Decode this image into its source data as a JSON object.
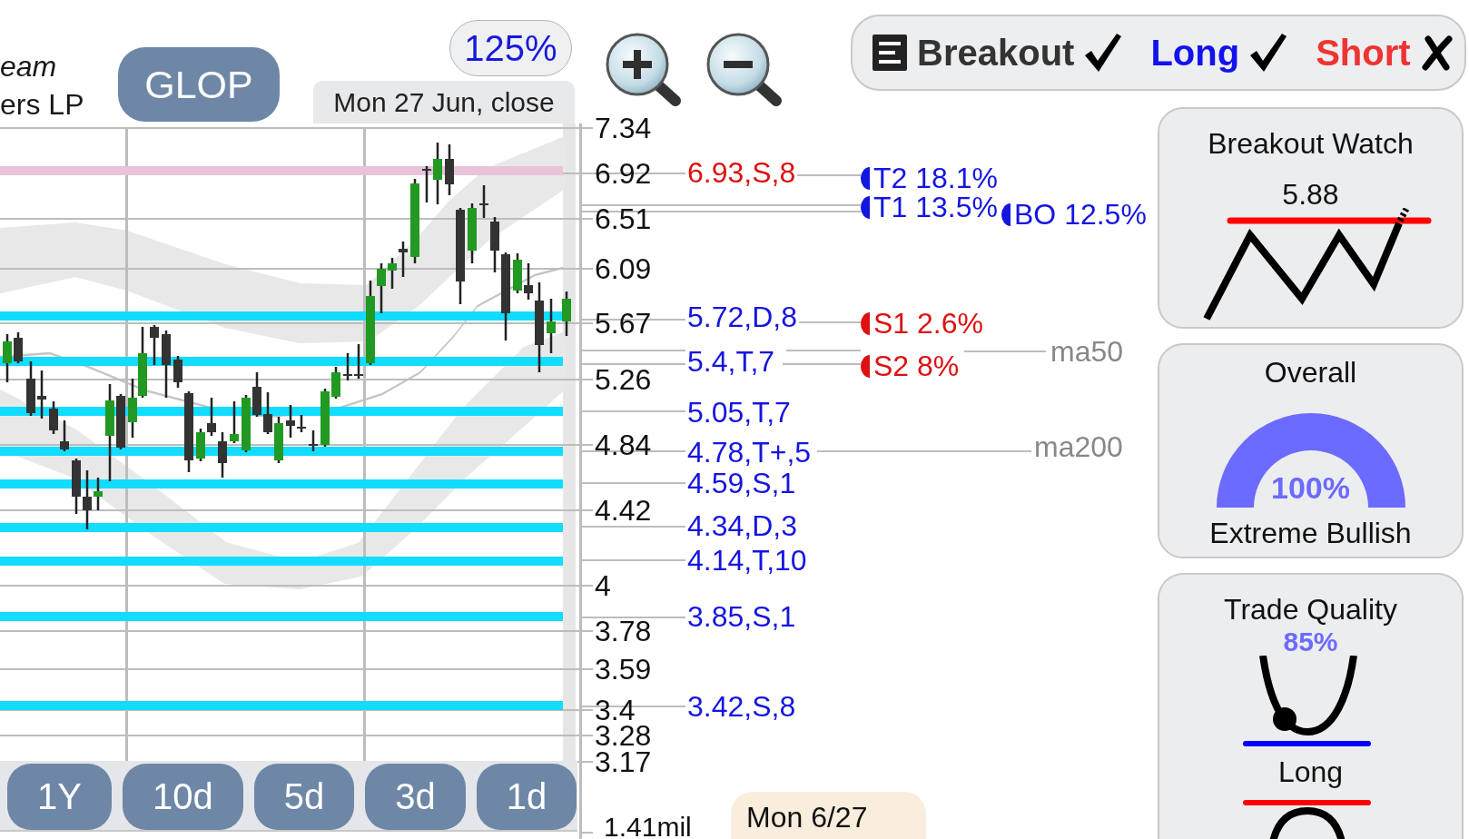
{
  "company": {
    "name": "eam",
    "subtitle": "ers LP"
  },
  "ticker": "GLOP",
  "zoom": "125%",
  "date_label": "Mon 27 Jun, close",
  "signals": [
    {
      "kind": "pattern",
      "label": "Breakout",
      "checked": true
    },
    {
      "kind": "long",
      "label": "Long",
      "checked": true
    },
    {
      "kind": "short",
      "label": "Short",
      "checked": false
    }
  ],
  "chart": {
    "price_ticks": [
      "7.34",
      "6.92",
      "6.51",
      "6.09",
      "5.67",
      "5.26",
      "4.84",
      "4.42",
      "4",
      "3.78",
      "3.59",
      "3.4",
      "3.28",
      "3.17"
    ],
    "levels": [
      {
        "label": "6.93,S,8",
        "kind": "resistance"
      },
      {
        "label": "5.72,D,8",
        "kind": "support"
      },
      {
        "label": "5.4,T,7",
        "kind": "support"
      },
      {
        "label": "5.05,T,7",
        "kind": "support"
      },
      {
        "label": "4.78,T+,5",
        "kind": "support"
      },
      {
        "label": "4.59,S,1",
        "kind": "support"
      },
      {
        "label": "4.34,D,3",
        "kind": "support"
      },
      {
        "label": "4.14,T,10",
        "kind": "support"
      },
      {
        "label": "3.85,S,1",
        "kind": "support"
      },
      {
        "label": "3.42,S,8",
        "kind": "support"
      }
    ],
    "targets": [
      {
        "label": "T2 18.1%",
        "kind": "target"
      },
      {
        "label": "T1 13.5%",
        "kind": "target"
      },
      {
        "label": "BO 12.5%",
        "kind": "target"
      },
      {
        "label": "S1 2.6%",
        "kind": "stop"
      },
      {
        "label": "S2 8%",
        "kind": "stop"
      }
    ],
    "averages": [
      "ma50",
      "ma200"
    ],
    "cursor_date": "Mon 6/27",
    "volume_tick": "1.41mil"
  },
  "ranges": [
    "1Y",
    "10d",
    "5d",
    "3d",
    "1d"
  ],
  "cards": [
    {
      "kind": "breakout",
      "title": "Breakout Watch",
      "value": "5.88"
    },
    {
      "kind": "gauge",
      "title": "Overall",
      "value": "100%",
      "level": 1,
      "caption": "Extreme Bullish"
    },
    {
      "kind": "quality",
      "title": "Trade Quality",
      "value": "85%",
      "caption": "Long"
    }
  ]
}
